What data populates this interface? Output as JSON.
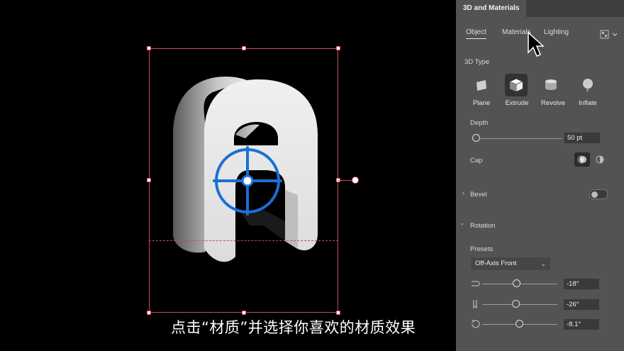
{
  "panel": {
    "title": "3D and Materials",
    "tabs": [
      "Object",
      "Materials",
      "Lighting"
    ],
    "active_tab": "Object",
    "type_section": "3D Type",
    "types": [
      "Plane",
      "Extrude",
      "Revolve",
      "Inflate"
    ],
    "selected_type": "Extrude",
    "depth_label": "Depth",
    "depth_value": "50 pt",
    "cap_label": "Cap",
    "bevel_label": "Bevel",
    "bevel_enabled": false,
    "rotation_label": "Rotation",
    "presets_label": "Presets",
    "preset_value": "Off-Axis Front",
    "rotation_x": "-18°",
    "rotation_y": "-26°",
    "rotation_z": "-8.1°"
  },
  "caption": "点击“材质”并选择你喜欢的材质效果",
  "canvas_glyph": "A",
  "colors": {
    "panel_bg": "#535353",
    "selection": "#c84a5a",
    "target_widget": "#1a6fd6"
  }
}
